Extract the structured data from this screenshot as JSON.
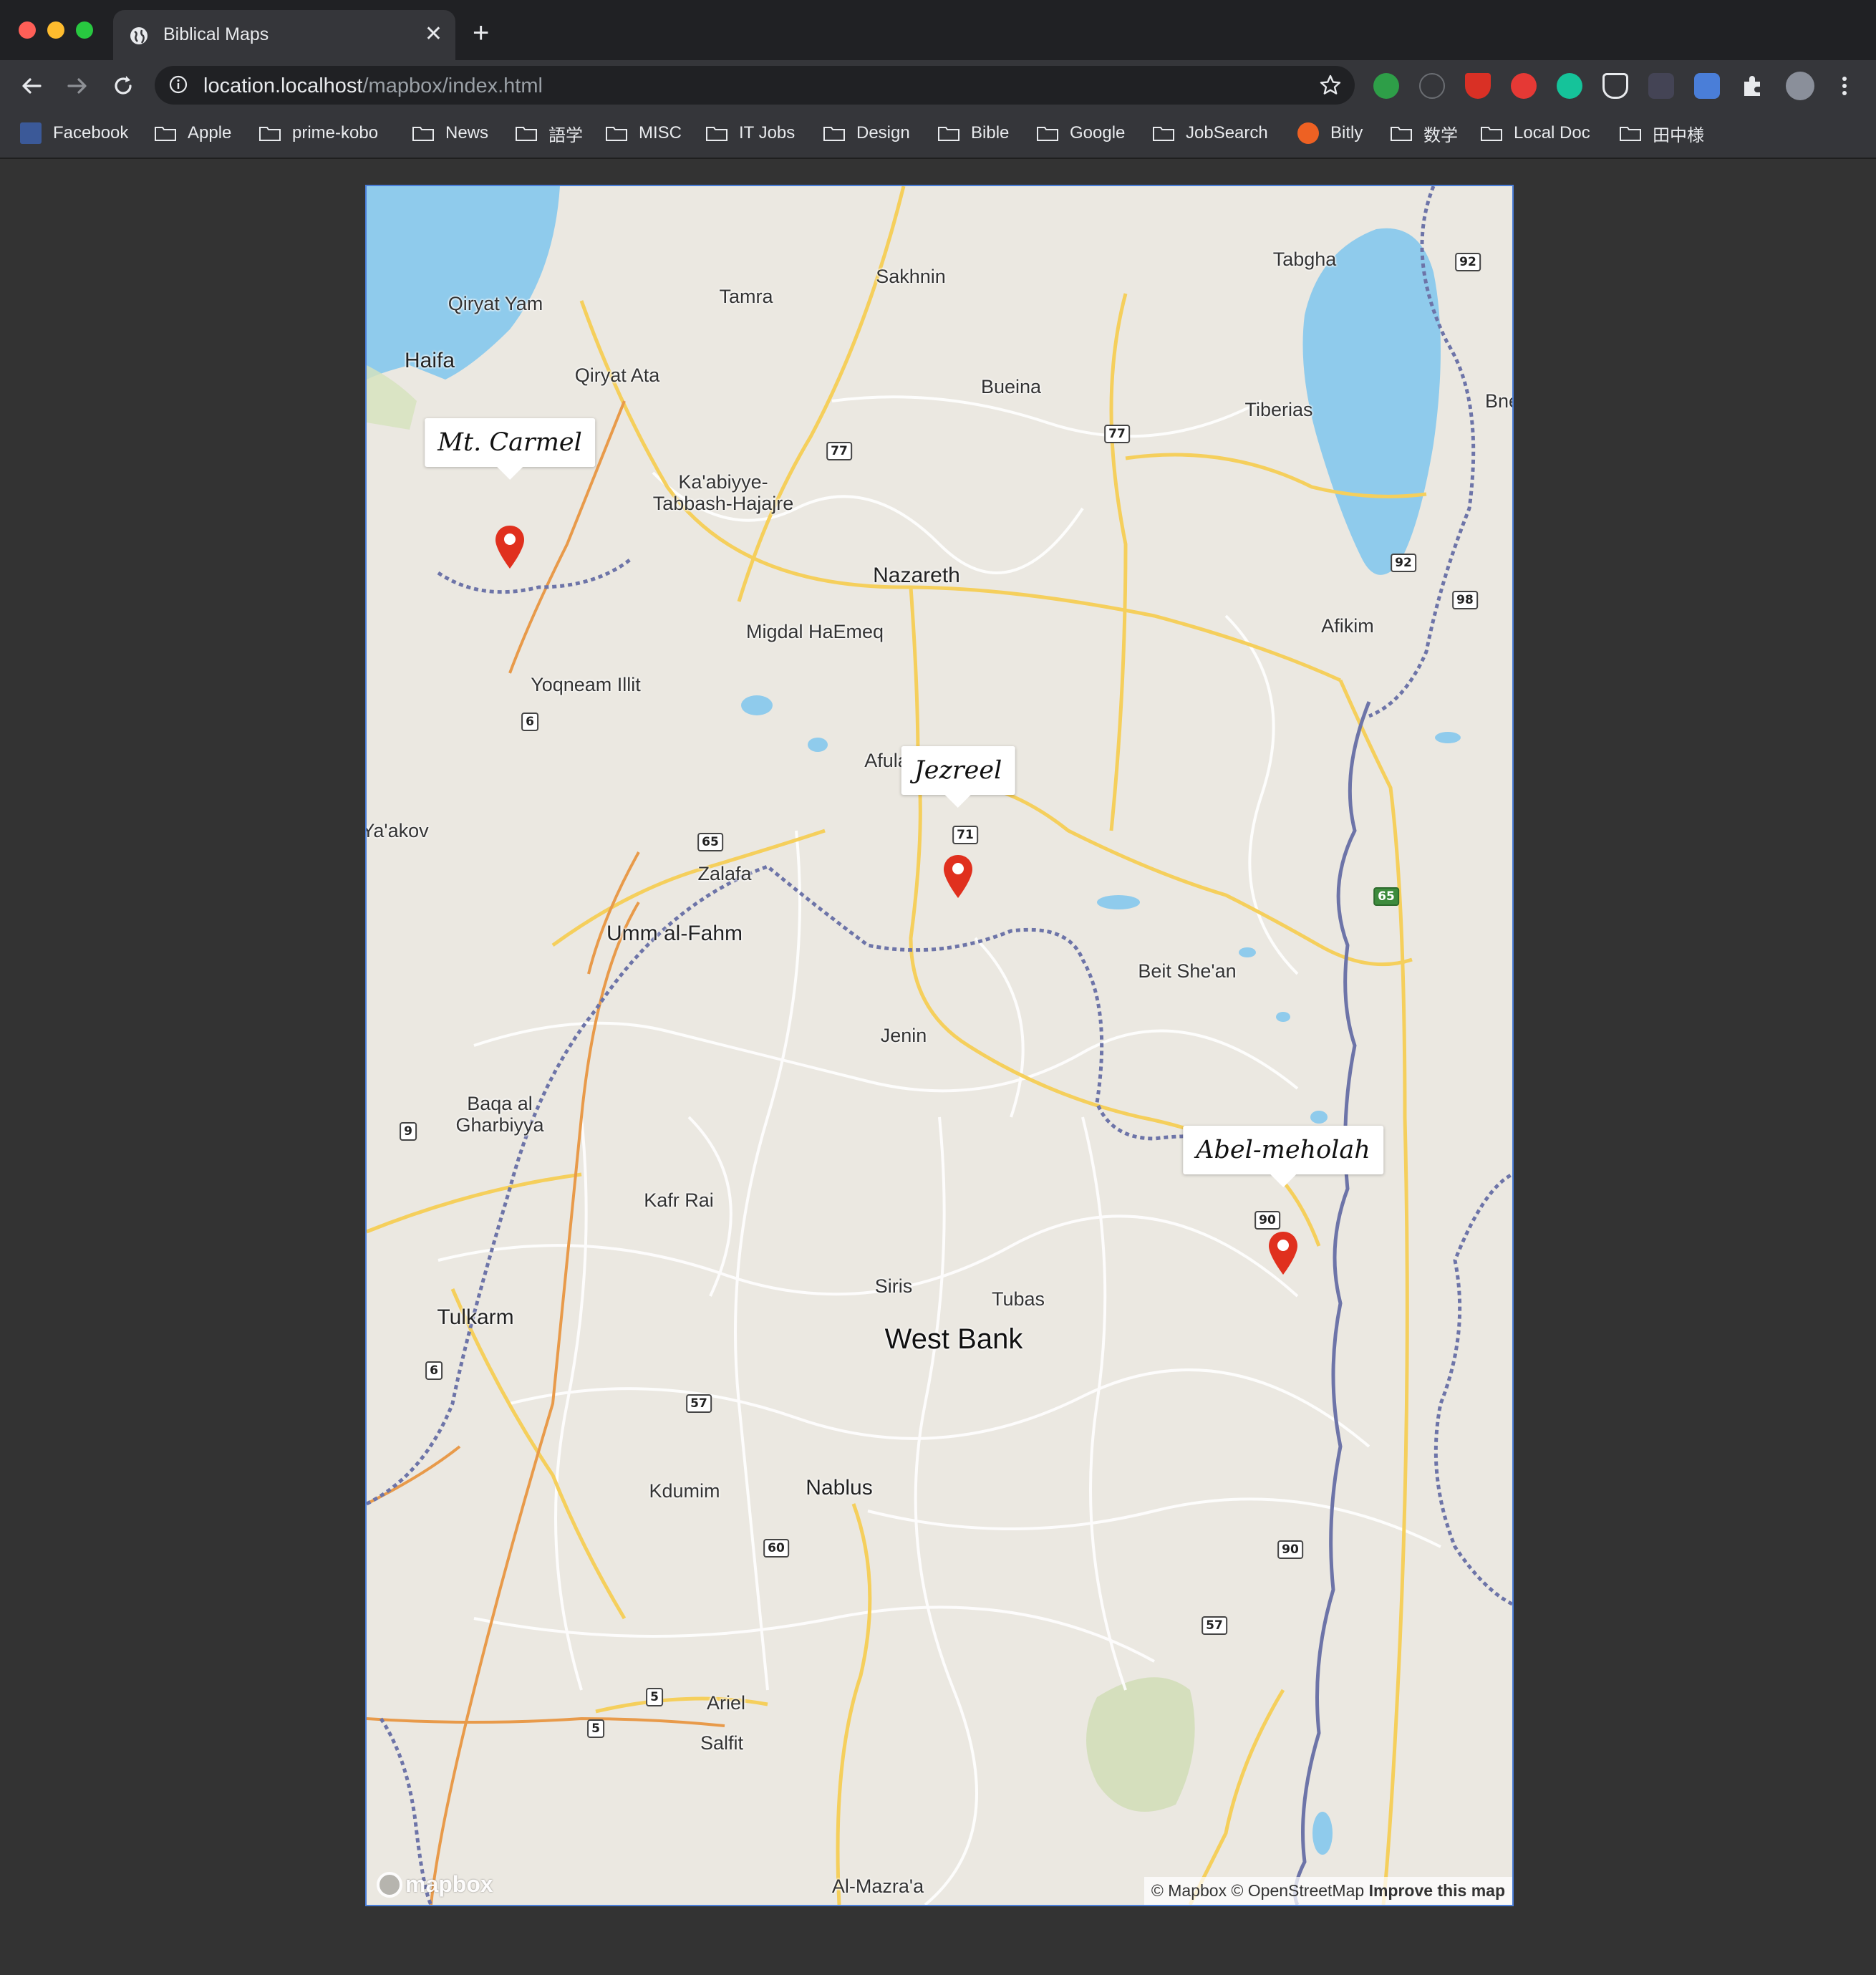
{
  "browser": {
    "tab_title": "Biblical Maps",
    "tab_close": "✕",
    "new_tab": "+",
    "url_host": "location.localhost",
    "url_path": "/mapbox/index.html"
  },
  "bookmarks": [
    "Facebook",
    "Apple",
    "prime-kobo",
    "News",
    "語学",
    "MISC",
    "IT Jobs",
    "Design",
    "Bible",
    "Google",
    "JobSearch",
    "Bitly",
    "数学",
    "Local Doc",
    "田中様"
  ],
  "map": {
    "places": {
      "haifa": "Haifa",
      "qiryat_yam": "Qiryat Yam",
      "qiryat_ata": "Qiryat Ata",
      "tamra": "Tamra",
      "sakhnin": "Sakhnin",
      "tabgha": "Tabgha",
      "bueina": "Bueina",
      "tiberias": "Tiberias",
      "bne": "Bne",
      "kabiyye": "Ka'abiyye-\nTabbash-Hajajre",
      "nazareth": "Nazareth",
      "migdal": "Migdal HaEmeq",
      "afikim": "Afikim",
      "yoqneam": "Yoqneam Illit",
      "afula": "Afula",
      "yaakov": "Ya'akov",
      "zalafa": "Zalafa",
      "umm": "Umm al-Fahm",
      "beit": "Beit She'an",
      "jenin": "Jenin",
      "baqa": "Baqa al\nGharbiyya",
      "kafr": "Kafr Rai",
      "siris": "Siris",
      "tubas": "Tubas",
      "westbank": "West Bank",
      "tulkarm": "Tulkarm",
      "kdumim": "Kdumim",
      "nablus": "Nablus",
      "ariel": "Ariel",
      "salfit": "Salfit",
      "mazra": "Al-Mazra'a"
    },
    "shields": {
      "s92a": "92",
      "s77a": "77",
      "s77b": "77",
      "s92b": "92",
      "s98": "98",
      "s6a": "6",
      "s71": "71",
      "s65": "65",
      "s65g": "65",
      "s9": "9",
      "s90a": "90",
      "s6b": "6",
      "s57a": "57",
      "s60": "60",
      "s90b": "90",
      "s57b": "57",
      "s5a": "5",
      "s5b": "5"
    },
    "popups": {
      "carmel": "Mt. Carmel",
      "jezreel": "Jezreel",
      "abel": "Abel-meholah"
    },
    "logo": "mapbox",
    "attribution": "© Mapbox © OpenStreetMap",
    "improve": "Improve this map"
  },
  "colors": {
    "pin": "#e0301e",
    "water": "#8fcbec",
    "land": "#ebe8e1",
    "road": "#f5cf5c",
    "highway": "#e89a4a",
    "border": "#6d74a8"
  }
}
